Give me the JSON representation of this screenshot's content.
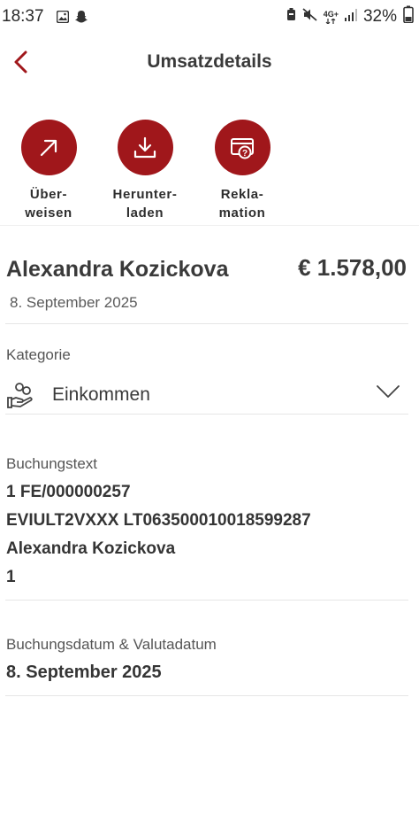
{
  "status_bar": {
    "time": "18:37",
    "network": "4G+",
    "battery": "32%"
  },
  "header": {
    "title": "Umsatzdetails"
  },
  "actions": [
    {
      "label": "Über-\nweisen",
      "icon": "arrow-up-right-icon"
    },
    {
      "label": "Herunter-\nladen",
      "icon": "download-icon"
    },
    {
      "label": "Rekla-\nmation",
      "icon": "complaint-icon"
    }
  ],
  "colors": {
    "accent": "#a0171b"
  },
  "transaction": {
    "name": "Alexandra Kozickova",
    "amount": "€ 1.578,00",
    "date": "8. September 2025"
  },
  "category": {
    "label": "Kategorie",
    "value": "Einkommen",
    "icon": "hand-coins-icon"
  },
  "booking_text": {
    "label": "Buchungstext",
    "lines": [
      "1 FE/000000257",
      "EVIULT2VXXX LT063500010018599287",
      "Alexandra Kozickova",
      "1"
    ]
  },
  "booking_date": {
    "label": "Buchungsdatum & Valutadatum",
    "value": "8. September 2025"
  }
}
